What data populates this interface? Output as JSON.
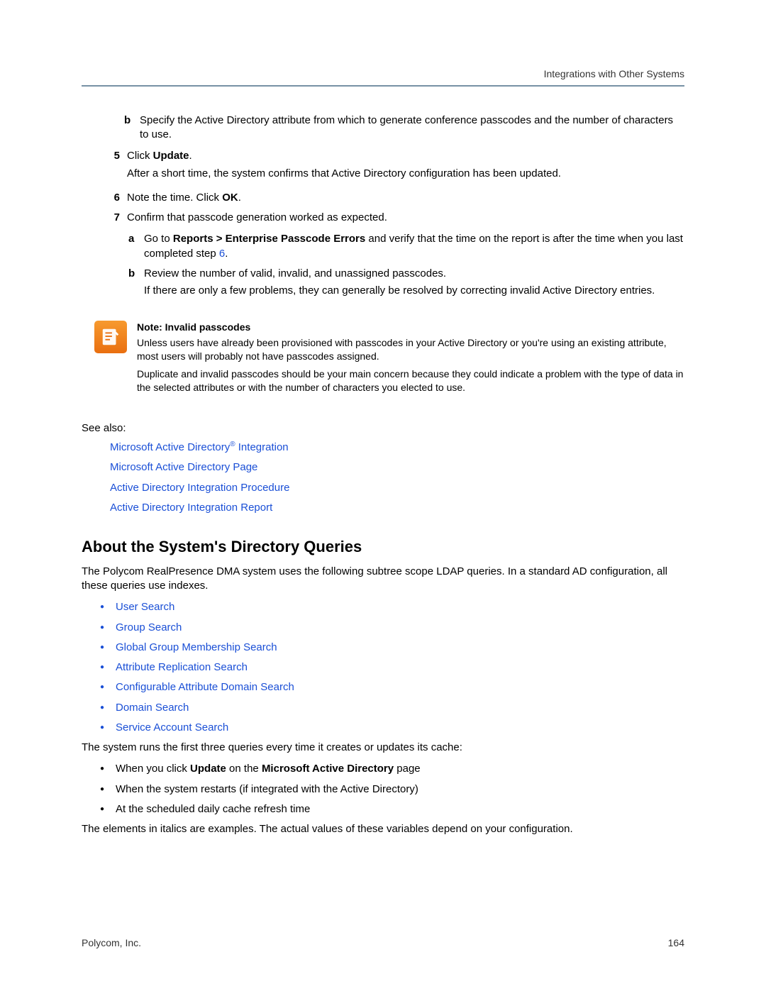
{
  "header": "Integrations with Other Systems",
  "steps": {
    "b_text": "Specify the Active Directory attribute from which to generate conference passcodes and the number of characters to use.",
    "s5_pre": "Click ",
    "s5_bold": "Update",
    "s5_post": ".",
    "s5_after": "After a short time, the system confirms that Active Directory configuration has been updated.",
    "s6_pre": "Note the time. Click ",
    "s6_bold": "OK",
    "s6_post": ".",
    "s7": "Confirm that passcode generation worked as expected.",
    "s7a_pre": "Go to ",
    "s7a_bold": "Reports > Enterprise Passcode Errors",
    "s7a_mid": " and verify that the time on the report is after the time when you last completed step ",
    "s7a_link": "6",
    "s7a_post": ".",
    "s7b": "Review the number of valid, invalid, and unassigned passcodes.",
    "s7b_after": "If there are only a few problems, they can generally be resolved by correcting invalid Active Directory entries."
  },
  "note": {
    "title": "Note: Invalid passcodes",
    "p1": "Unless users have already been provisioned with passcodes in your Active Directory or you're using an existing attribute, most users will probably not have passcodes assigned.",
    "p2": "Duplicate and invalid passcodes should be your main concern because they could indicate a problem with the type of data in the selected attributes or with the number of characters you elected to use."
  },
  "see_also_label": "See also:",
  "see_also_links": {
    "l1_pre": "Microsoft Active Directory",
    "l1_post": " Integration",
    "l2": "Microsoft Active Directory Page",
    "l3": "Active Directory Integration Procedure",
    "l4": "Active Directory Integration Report"
  },
  "section_title": "About the System's Directory Queries",
  "intro": "The Polycom RealPresence DMA system uses the following subtree scope LDAP queries. In a standard AD configuration, all these queries use indexes.",
  "query_links": {
    "q1": "User Search",
    "q2": "Group Search",
    "q3": "Global Group Membership Search",
    "q4": "Attribute Replication Search",
    "q5": "Configurable Attribute Domain Search",
    "q6": "Domain Search",
    "q7": "Service Account Search"
  },
  "runs_intro": "The system runs the first three queries every time it creates or updates its cache:",
  "run_items": {
    "r1_pre": "When you click ",
    "r1_b1": "Update",
    "r1_mid": " on the ",
    "r1_b2": "Microsoft Active Directory",
    "r1_post": " page",
    "r2": "When the system restarts (if integrated with the Active Directory)",
    "r3": "At the scheduled daily cache refresh time"
  },
  "closing": "The elements in italics are examples. The actual values of these variables depend on your configuration.",
  "footer_left": "Polycom, Inc.",
  "footer_right": "164"
}
